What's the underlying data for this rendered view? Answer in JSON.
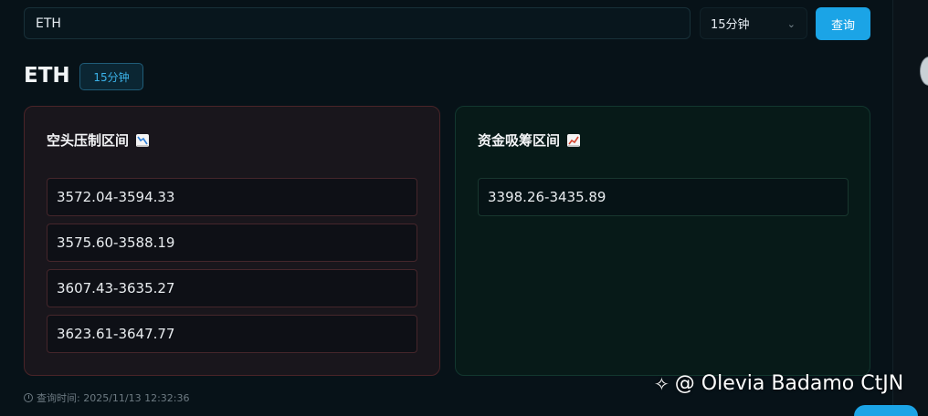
{
  "search": {
    "value": "ETH"
  },
  "interval_select": {
    "selected": "15分钟"
  },
  "query_button": {
    "label": "查询"
  },
  "header": {
    "symbol": "ETH",
    "interval_badge": "15分钟"
  },
  "short_panel": {
    "title": "空头压制区间",
    "icon": "chart-decreasing-icon",
    "ranges": [
      "3572.04-3594.33",
      "3575.60-3588.19",
      "3607.43-3635.27",
      "3623.61-3647.77"
    ]
  },
  "accum_panel": {
    "title": "资金吸筹区间",
    "icon": "chart-increasing-icon",
    "ranges": [
      "3398.26-3435.89"
    ]
  },
  "footer": {
    "query_time": "查询时间: 2025/11/13 12:32:36"
  },
  "watermark": {
    "text": "@ Olevia Badamo CtJN"
  },
  "colors": {
    "accent": "#1ba4e6",
    "short_border": "#4a2428",
    "accum_border": "#12372f",
    "background": "#071218"
  }
}
